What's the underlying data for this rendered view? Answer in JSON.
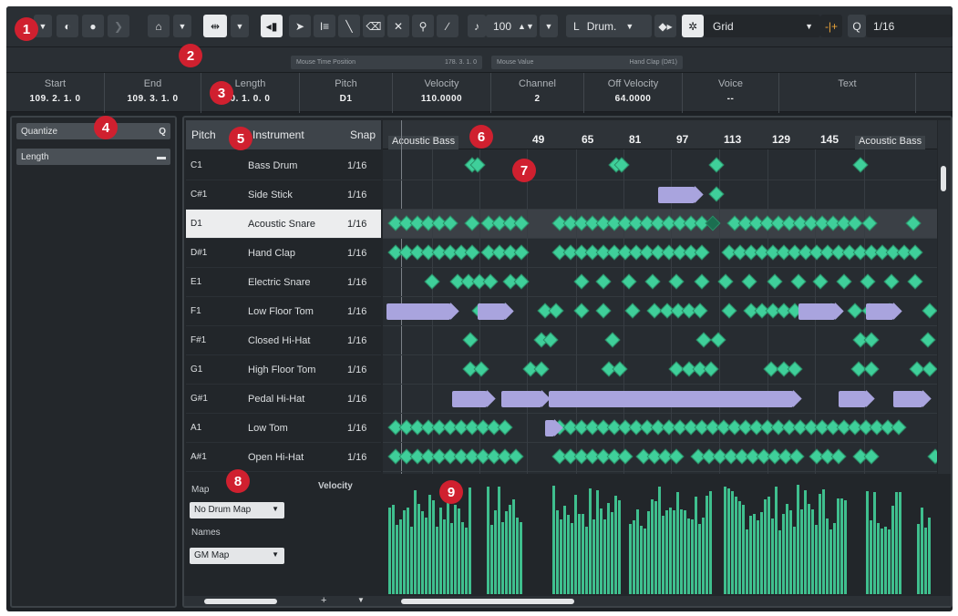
{
  "toolbar": {
    "volume_value": "100",
    "drum_label": "L",
    "drum_value": "Drum.",
    "grid_value": "Grid",
    "quantize_value": "1/16"
  },
  "status": {
    "mouse_time_label": "Mouse Time Position",
    "mouse_time_value": "178. 3. 1.   0",
    "mouse_value_label": "Mouse Value",
    "mouse_value_value": "Hand Clap (D#1)"
  },
  "infoline": [
    {
      "label": "Start",
      "value": "109. 2. 1.   0"
    },
    {
      "label": "End",
      "value": "109. 3. 1.   0"
    },
    {
      "label": "Length",
      "value": "0. 1. 0.   0"
    },
    {
      "label": "Pitch",
      "value": "D1"
    },
    {
      "label": "Velocity",
      "value": "110.0000"
    },
    {
      "label": "Channel",
      "value": "2"
    },
    {
      "label": "Off Velocity",
      "value": "64.0000"
    },
    {
      "label": "Voice",
      "value": "--"
    },
    {
      "label": "Text",
      "value": ""
    }
  ],
  "inspector": {
    "quantize_label": "Quantize",
    "quantize_icon": "Q",
    "length_label": "Length"
  },
  "drum_list": {
    "headers": {
      "pitch": "Pitch",
      "instrument": "Instrument",
      "snap": "Snap"
    },
    "rows": [
      {
        "pitch": "C1",
        "instrument": "Bass Drum",
        "snap": "1/16"
      },
      {
        "pitch": "C#1",
        "instrument": "Side Stick",
        "snap": "1/16"
      },
      {
        "pitch": "D1",
        "instrument": "Acoustic Snare",
        "snap": "1/16"
      },
      {
        "pitch": "D#1",
        "instrument": "Hand Clap",
        "snap": "1/16"
      },
      {
        "pitch": "E1",
        "instrument": "Electric Snare",
        "snap": "1/16"
      },
      {
        "pitch": "F1",
        "instrument": "Low Floor Tom",
        "snap": "1/16"
      },
      {
        "pitch": "F#1",
        "instrument": "Closed Hi-Hat",
        "snap": "1/16"
      },
      {
        "pitch": "G1",
        "instrument": "High Floor Tom",
        "snap": "1/16"
      },
      {
        "pitch": "G#1",
        "instrument": "Pedal Hi-Hat",
        "snap": "1/16"
      },
      {
        "pitch": "A1",
        "instrument": "Low Tom",
        "snap": "1/16"
      },
      {
        "pitch": "A#1",
        "instrument": "Open Hi-Hat",
        "snap": "1/16"
      }
    ]
  },
  "ruler": {
    "part_name_left": "Acoustic Bass",
    "part_name_right": "Acoustic Bass",
    "ticks": [
      "49",
      "65",
      "81",
      "97",
      "113",
      "129",
      "145"
    ]
  },
  "lower_zone": {
    "map_label": "Map",
    "map_value": "No Drum Map",
    "names_label": "Names",
    "names_value": "GM Map",
    "velocity_label": "Velocity"
  },
  "callouts": [
    "1",
    "2",
    "3",
    "4",
    "5",
    "6",
    "7",
    "8",
    "9"
  ],
  "colors": {
    "note": "#3fcf9a",
    "long_note": "#a9a4de",
    "velocity": "#3fbf8e",
    "callout": "#d0202f"
  }
}
